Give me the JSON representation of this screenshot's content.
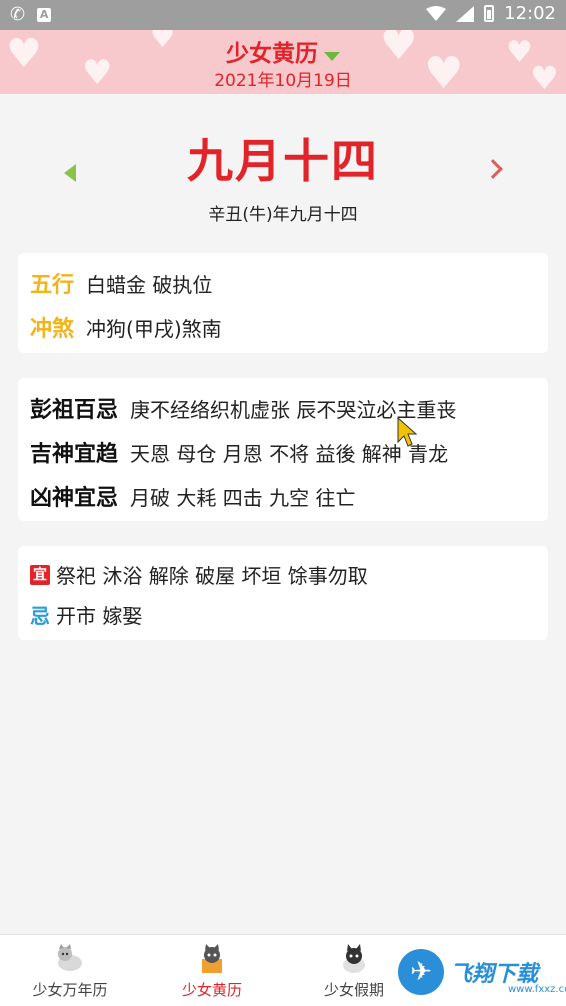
{
  "status_bar": {
    "time": "12:02"
  },
  "header": {
    "title": "少女黄历",
    "date": "2021年10月19日"
  },
  "lunar": {
    "big": "九月十四",
    "sub": "辛丑(牛)年九月十四"
  },
  "card1": {
    "wuxing_label": "五行",
    "wuxing_value": "白蜡金 破执位",
    "chongsha_label": "冲煞",
    "chongsha_value": "冲狗(甲戌)煞南"
  },
  "card2": {
    "pengzu_label": "彭祖百忌",
    "pengzu_value": "庚不经络织机虚张 辰不哭泣必主重丧",
    "jishen_label": "吉神宜趋",
    "jishen_value": "天恩 母仓 月恩 不将 益後 解神 青龙",
    "xiongshen_label": "凶神宜忌",
    "xiongshen_value": "月破 大耗 四击 九空 往亡"
  },
  "card3": {
    "yi_label": "宜",
    "yi_value": "祭祀 沐浴 解除 破屋 坏垣 馀事勿取",
    "ji_label": "忌",
    "ji_value": "开市 嫁娶"
  },
  "tabs": [
    {
      "label": "少女万年历",
      "icon": "corgi-icon"
    },
    {
      "label": "少女黄历",
      "icon": "cat-box-icon"
    },
    {
      "label": "少女假期",
      "icon": "cat-hat-icon"
    }
  ],
  "watermark": {
    "text": "飞翔下载",
    "url": "www.fxxz.com"
  },
  "colors": {
    "accent_red": "#e0242a",
    "header_pink": "#f7c9cd",
    "label_yellow": "#f2b418",
    "ji_blue": "#2e9bd6"
  }
}
